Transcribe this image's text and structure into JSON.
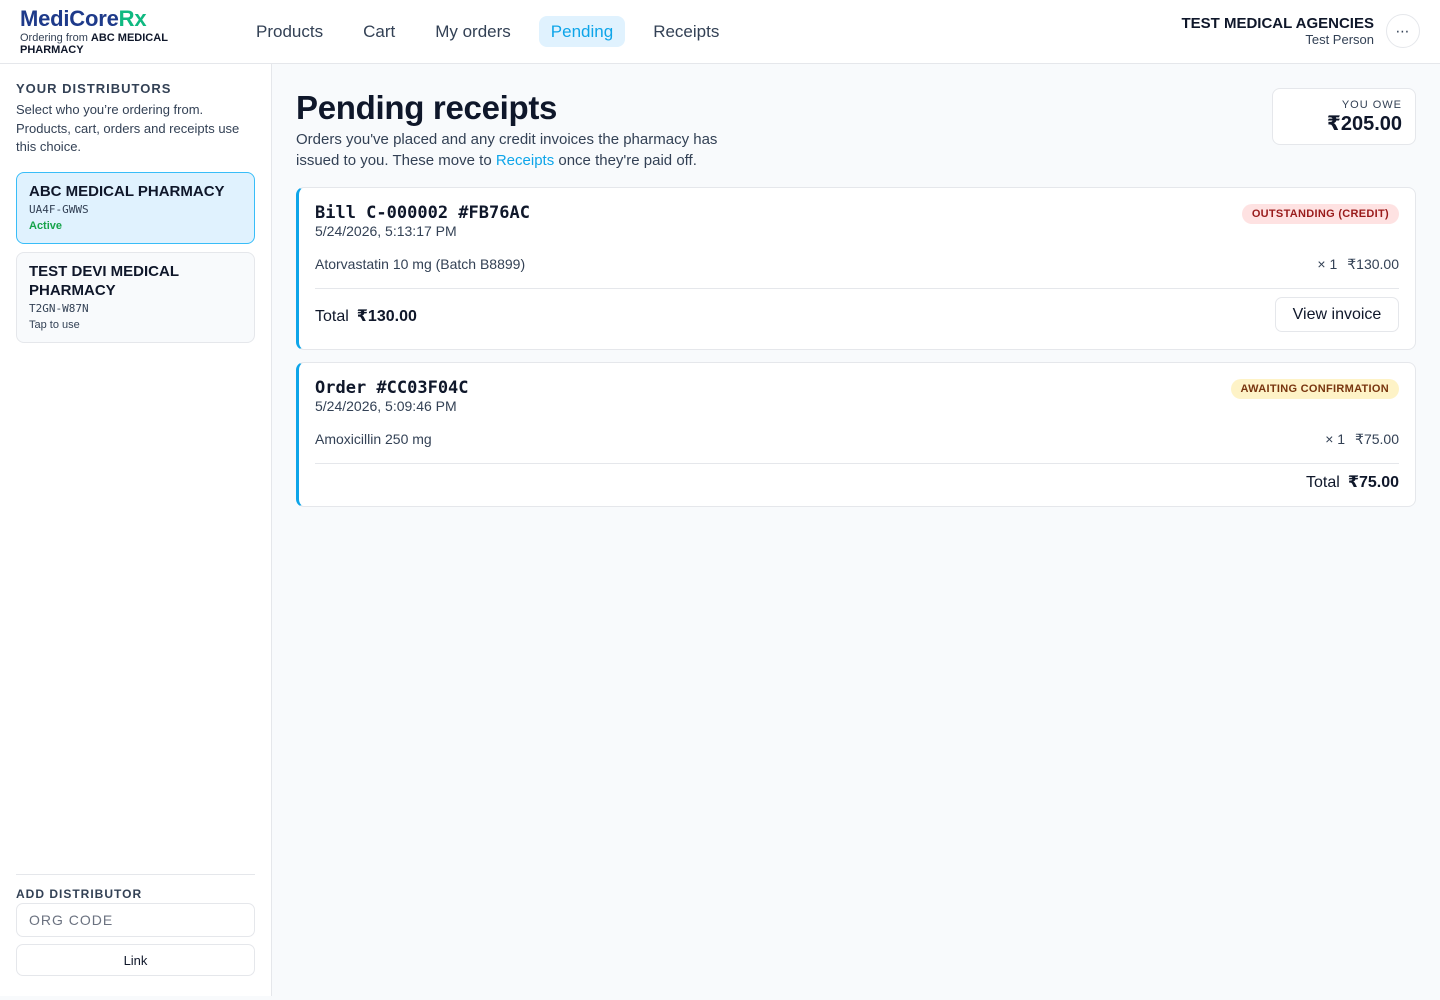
{
  "brand": {
    "name_part1": "MediCore",
    "name_part2": "Rx",
    "ordering_prefix": "Ordering from ",
    "ordering_from": "ABC MEDICAL PHARMACY"
  },
  "nav": {
    "items": [
      {
        "label": "Products"
      },
      {
        "label": "Cart"
      },
      {
        "label": "My orders"
      },
      {
        "label": "Pending",
        "active": true
      },
      {
        "label": "Receipts"
      }
    ]
  },
  "account": {
    "org": "TEST MEDICAL AGENCIES",
    "user": "Test Person",
    "more_icon": "⋯"
  },
  "sidebar": {
    "title": "YOUR DISTRIBUTORS",
    "description": "Select who you’re ordering from. Products, cart, orders and receipts use this choice.",
    "distributors": [
      {
        "name": "ABC MEDICAL PHARMACY",
        "code": "UA4F-GWWS",
        "status": "Active",
        "active": true
      },
      {
        "name": "TEST DEVI MEDICAL PHARMACY",
        "code": "T2GN-W87N",
        "status": "Tap to use",
        "active": false
      }
    ],
    "add_title": "ADD DISTRIBUTOR",
    "org_code_placeholder": "ORG CODE",
    "link_label": "Link"
  },
  "main": {
    "title": "Pending receipts",
    "desc_before": "Orders you've placed and any credit invoices the pharmacy has issued to you. These move to ",
    "desc_link": "Receipts",
    "desc_after": " once they're paid off.",
    "owe_label": "YOU OWE",
    "owe_amount": "₹205.00",
    "cards": [
      {
        "id": "Bill C-000002 #FB76AC",
        "date": "5/24/2026, 5:13:17 PM",
        "badge": "OUTSTANDING (CREDIT)",
        "item": "Atorvastatin 10 mg (Batch B8899)",
        "qty": "× 1",
        "price": "₹130.00",
        "total_label": "Total",
        "total": "₹130.00",
        "action": "View invoice"
      },
      {
        "id": "Order #CC03F04C",
        "date": "5/24/2026, 5:09:46 PM",
        "badge": "AWAITING CONFIRMATION",
        "item": "Amoxicillin 250 mg",
        "qty": "× 1",
        "price": "₹75.00",
        "total_label": "Total",
        "total": "₹75.00"
      }
    ]
  },
  "colors": {
    "accent": "#0ea5e9",
    "brand_blue": "#1e3a8a",
    "brand_green": "#10b981",
    "active_green": "#16a34a"
  }
}
